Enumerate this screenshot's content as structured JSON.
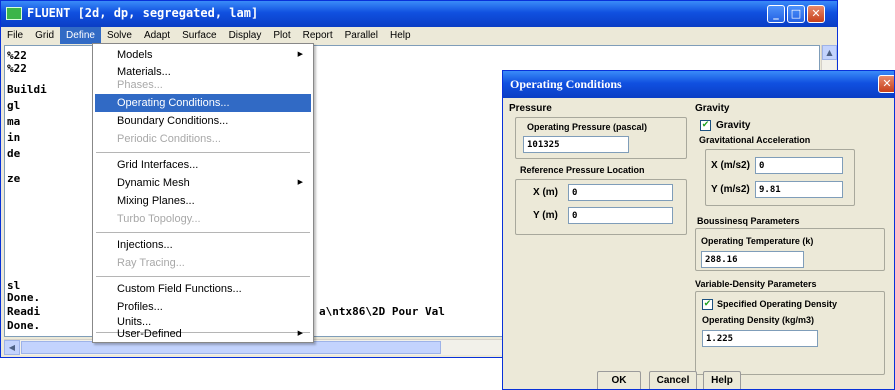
{
  "window": {
    "title": "FLUENT  [2d, dp, segregated, lam]",
    "controls": {
      "minimize": "_",
      "maximize": "□",
      "close": "✕"
    }
  },
  "menubar": {
    "items": [
      {
        "label": "File"
      },
      {
        "label": "Grid"
      },
      {
        "label": "Define",
        "active": true
      },
      {
        "label": "Solve"
      },
      {
        "label": "Adapt"
      },
      {
        "label": "Surface"
      },
      {
        "label": "Display"
      },
      {
        "label": "Plot"
      },
      {
        "label": "Report"
      },
      {
        "label": "Parallel"
      },
      {
        "label": "Help"
      }
    ]
  },
  "console": {
    "lines": [
      "    %22",
      "    %22",
      "Buildi",
      "       gl",
      "       ma",
      "       in",
      "       de",
      "       ze",
      "       sl",
      "Done.",
      "Readi",
      "Done."
    ],
    "overflow_text": "a\\ntx86\\2D Pour Val"
  },
  "define_menu": {
    "items": [
      {
        "label": "Models",
        "submenu": true
      },
      {
        "label": "Materials..."
      },
      {
        "label": "Phases...",
        "disabled": true
      },
      {
        "label": "Operating Conditions...",
        "highlighted": true
      },
      {
        "label": "Boundary Conditions..."
      },
      {
        "label": "Periodic Conditions...",
        "disabled": true
      },
      {
        "label": "Grid Interfaces..."
      },
      {
        "label": "Dynamic Mesh",
        "submenu": true
      },
      {
        "label": "Mixing Planes..."
      },
      {
        "label": "Turbo Topology...",
        "disabled": true
      },
      {
        "label": "Injections..."
      },
      {
        "label": "Ray Tracing...",
        "disabled": true
      },
      {
        "label": "Custom Field Functions..."
      },
      {
        "label": "Profiles..."
      },
      {
        "label": "Units..."
      },
      {
        "label": "User-Defined",
        "submenu": true
      }
    ]
  },
  "dialog": {
    "title": "Operating Conditions",
    "close": "✕",
    "pressure": {
      "heading": "Pressure",
      "operating_pressure_label": "Operating Pressure (pascal)",
      "operating_pressure_value": "101325",
      "reference_location_heading": "Reference Pressure Location",
      "x_label": "X (m)",
      "x_value": "0",
      "y_label": "Y (m)",
      "y_value": "0"
    },
    "gravity": {
      "heading": "Gravity",
      "gravity_checkbox_label": "Gravity",
      "gravity_checked": true,
      "acceleration_heading": "Gravitational Acceleration",
      "x_label": "X (m/s2)",
      "x_value": "0",
      "y_label": "Y (m/s2)",
      "y_value": "9.81"
    },
    "boussinesq": {
      "heading": "Boussinesq Parameters",
      "temperature_label": "Operating Temperature (k)",
      "temperature_value": "288.16"
    },
    "variable_density": {
      "heading": "Variable-Density Parameters",
      "specified_density_label": "Specified Operating Density",
      "specified_checked": true,
      "density_label": "Operating Density (kg/m3)",
      "density_value": "1.225"
    },
    "buttons": {
      "ok": "OK",
      "cancel": "Cancel",
      "help": "Help"
    }
  }
}
